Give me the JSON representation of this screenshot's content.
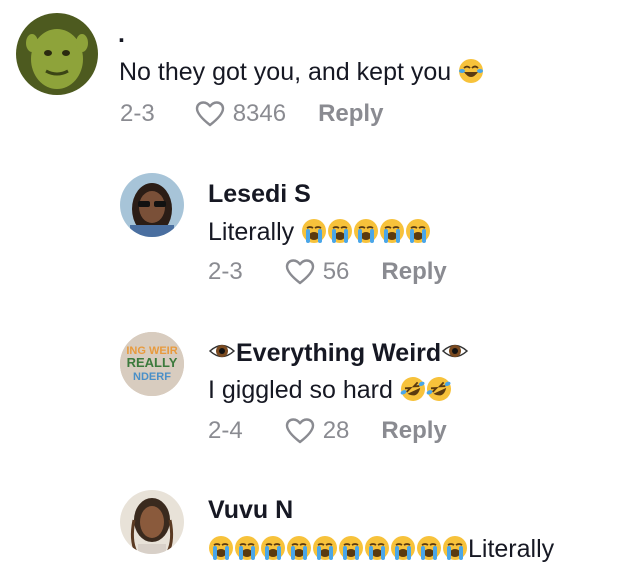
{
  "comments": [
    {
      "username": ".",
      "text": "No they got you, and kept you",
      "emojis": [
        "joy"
      ],
      "date": "2-3",
      "likes": "8346",
      "reply_label": "Reply",
      "avatar_color": "#7a8a2a"
    },
    {
      "username": "Lesedi S",
      "text": "Literally",
      "emojis": [
        "sob",
        "sob",
        "sob",
        "sob",
        "sob"
      ],
      "date": "2-3",
      "likes": "56",
      "reply_label": "Reply",
      "avatar_color": "#5a4030"
    },
    {
      "username": "Everything Weird",
      "name_prefix_icon": "eye",
      "name_suffix_icon": "eye",
      "text": "I giggled so hard",
      "emojis": [
        "rofl",
        "rofl"
      ],
      "date": "2-4",
      "likes": "28",
      "reply_label": "Reply",
      "avatar_text_lines": [
        "ING WEIR",
        "REALLY",
        "NDERF"
      ],
      "avatar_color": "#d8c8b8"
    },
    {
      "username": "Vuvu N",
      "text": "Literally",
      "emojis_before_text": [
        "sob",
        "sob",
        "sob",
        "sob",
        "sob",
        "sob",
        "sob",
        "sob",
        "sob",
        "sob"
      ],
      "avatar_color": "#6b4a35"
    }
  ],
  "colors": {
    "text": "#161823",
    "meta": "#8a8b91",
    "emoji_face": "#f7c23b",
    "emoji_tear": "#4aa6e8"
  }
}
